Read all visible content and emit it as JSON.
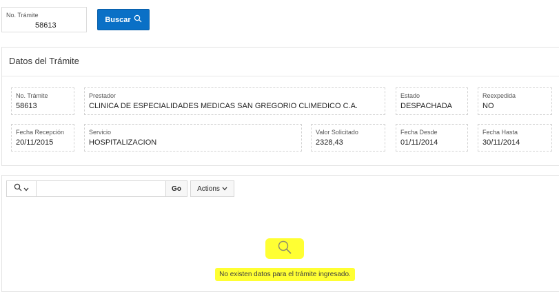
{
  "search": {
    "field_label": "No. Trámite",
    "field_value": "58613",
    "button_label": "Buscar"
  },
  "datos": {
    "title": "Datos del Trámite",
    "fields": {
      "no_tramite": {
        "label": "No. Trámite",
        "value": "58613"
      },
      "prestador": {
        "label": "Prestador",
        "value": "CLINICA DE ESPECIALIDADES MEDICAS SAN GREGORIO CLIMEDICO C.A."
      },
      "estado": {
        "label": "Estado",
        "value": "DESPACHADA"
      },
      "reexpedida": {
        "label": "Reexpedida",
        "value": "NO"
      },
      "fecha_recepcion": {
        "label": "Fecha Recepción",
        "value": "20/11/2015"
      },
      "servicio": {
        "label": "Servicio",
        "value": "HOSPITALIZACION"
      },
      "valor_solicitado": {
        "label": "Valor Solicitado",
        "value": "2328,43"
      },
      "fecha_desde": {
        "label": "Fecha Desde",
        "value": "01/11/2014"
      },
      "fecha_hasta": {
        "label": "Fecha Hasta",
        "value": "30/11/2014"
      }
    }
  },
  "report": {
    "go_label": "Go",
    "actions_label": "Actions",
    "empty_message": "No existen datos para el trámite ingresado."
  },
  "colors": {
    "primary_button": "#0a70c6",
    "highlight": "#ffff33"
  },
  "icons": {
    "search_button": "search-icon",
    "column_search": "search-icon",
    "dropdown": "chevron-down-icon",
    "empty_state": "search-icon"
  }
}
